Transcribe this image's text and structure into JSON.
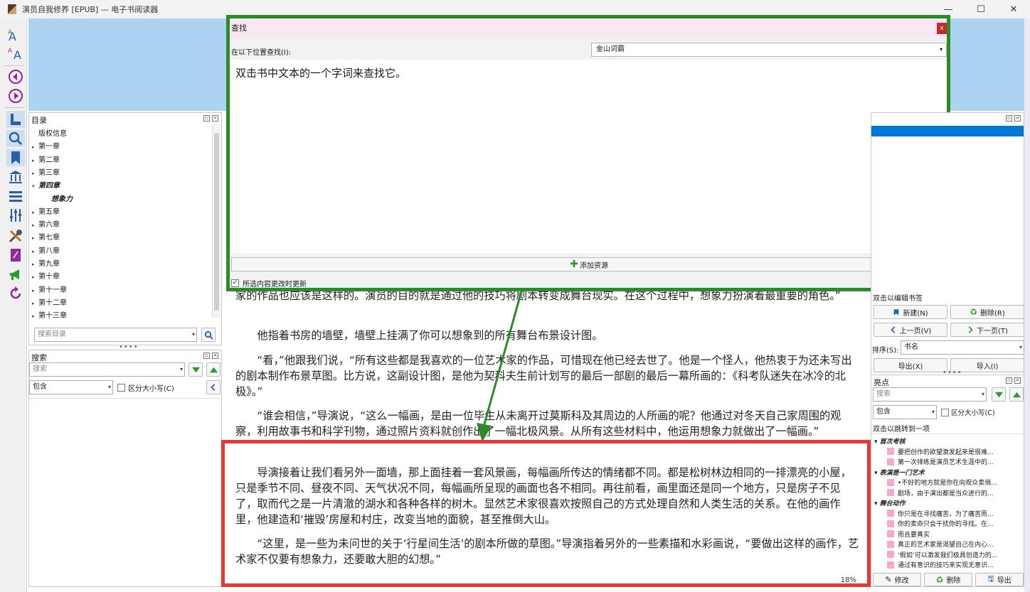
{
  "window": {
    "title": "演员自我修养 [EPUB] — 电子书阅读器",
    "minimize": "—",
    "maximize": "☐",
    "close": "✕"
  },
  "toolbar": {
    "buttons": [
      "font-larger-icon",
      "font-smaller-icon",
      "back-icon",
      "forward-icon",
      "toc-icon",
      "search-icon",
      "bookmark-icon",
      "library-icon",
      "menu-icon",
      "settings-icon",
      "tools-icon",
      "notes-icon",
      "announce-icon",
      "reload-icon"
    ]
  },
  "toc_panel": {
    "title": "目录",
    "items": [
      {
        "label": "版权信息",
        "expander": ""
      },
      {
        "label": "第一章",
        "expander": "▸"
      },
      {
        "label": "第二章",
        "expander": "▸"
      },
      {
        "label": "第三章",
        "expander": "▸"
      },
      {
        "label": "第四章",
        "expander": "▾"
      },
      {
        "label": "想象力",
        "expander": ""
      },
      {
        "label": "第五章",
        "expander": "▸"
      },
      {
        "label": "第六章",
        "expander": "▸"
      },
      {
        "label": "第七章",
        "expander": "▸"
      },
      {
        "label": "第八章",
        "expander": "▸"
      },
      {
        "label": "第九章",
        "expander": "▸"
      },
      {
        "label": "第十章",
        "expander": "▸"
      },
      {
        "label": "第十一章",
        "expander": "▸"
      },
      {
        "label": "第十二章",
        "expander": "▸"
      },
      {
        "label": "第十三章",
        "expander": "▸"
      }
    ],
    "search_placeholder": "搜索目录"
  },
  "search_panel": {
    "title": "搜索",
    "placeholder": "搜索",
    "mode": "包含",
    "case_sensitive_label": "区分大小写(C)"
  },
  "dialog": {
    "title": "查找",
    "lookup_label": "在以下位置查找(I):",
    "source": "金山词霸",
    "content": "双击书中文本的一个字词来查找它。",
    "add_source_label": "添加资源",
    "auto_update_label": "所选内容更改时更新",
    "auto_update_checked": "✓"
  },
  "reader": {
    "paragraphs": [
      "家的作品也应该是这样的。演员的目的就是通过他的技巧将剧本转变成舞台现实。在这个过程中，想象力扮演着最重要的角色。”",
      "他指着书房的墙壁，墙壁上挂满了你可以想象到的所有舞台布景设计图。",
      "“看，”他跟我们说，“所有这些都是我喜欢的一位艺术家的作品，可惜现在他已经去世了。他是一个怪人，他热衷于为还未写出的剧本制作布景草图。比方说，这副设计图，是他为契科夫生前计划写的最后一部剧的最后一幕所画的：《科考队迷失在冰冷的北极》。”",
      "“谁会相信，”导演说，“这么一幅画，是由一位毕生从未离开过莫斯科及其周边的人所画的呢？他通过对冬天自己家周围的观察，利用故事书和科学刊物，通过照片资料就创作出了一幅北极风景。从所有这些材料中，他运用想象力就做出了一幅画。”",
      "导演接着让我们看另外一面墙，那上面挂着一套风景画，每幅画所传达的情绪都不同。都是松树林边相同的一排漂亮的小屋，只是季节不同、昼夜不同、天气状况不同，每幅画所呈现的画面也各不相同。再往前看，画里面还是同一个地方，只是房子不见了，取而代之是一片清澈的湖水和各种各样的树木。显然艺术家很喜欢按照自己的方式处理自然和人类生活的关系。在他的画作里，他建造和‘摧毁’房屋和村庄，改变当地的面貌，甚至推倒大山。",
      "“这里，是一些为未问世的关于‘行星间生活’的剧本所做的草图。”导演指着另外的一些素描和水彩画说，“要做出这样的画作，艺术家不仅要有想象力，还要敢大胆的幻想。”"
    ],
    "progress": "18%"
  },
  "bookmarks_panel": {
    "hint": "双击以编辑书签",
    "new_label": "新建(N)",
    "delete_label": "删除(R)",
    "prev_label": "上一页(V)",
    "next_label": "下一页(T)",
    "sort_label": "排序(S):",
    "sort_value": "书名",
    "export_label": "导出(X)",
    "import_label": "导入(I)"
  },
  "highlights_panel": {
    "title": "亮点",
    "placeholder": "搜索",
    "mode": "包含",
    "case_sensitive_label": "区分大小写(C)",
    "hint": "双击以跳转到一项",
    "groups": [
      {
        "name": "首次考核",
        "items": [
          "要把创作的欲望激发起来是很难...",
          "第一次排练是演员艺术生涯中的..."
        ]
      },
      {
        "name": "表演是一门艺术",
        "items": [
          "•不好的地方就是你在向观众卖俏...",
          "剧场，由于演出都是当众进行的..."
        ]
      },
      {
        "name": "舞台动作",
        "items": [
          "你只是在寻找痛苦，为了痛苦而...",
          "你的卖命只会干扰你的寻找。在...",
          "而且要真实",
          "真正的艺术家是渴望自己在内心...",
          "‘假如’可以激发我们极具创造力的...",
          "通过有意识的技巧来实现无意识..."
        ]
      }
    ],
    "modify_label": "修改",
    "delete_label": "删除",
    "export_label": "导出"
  }
}
